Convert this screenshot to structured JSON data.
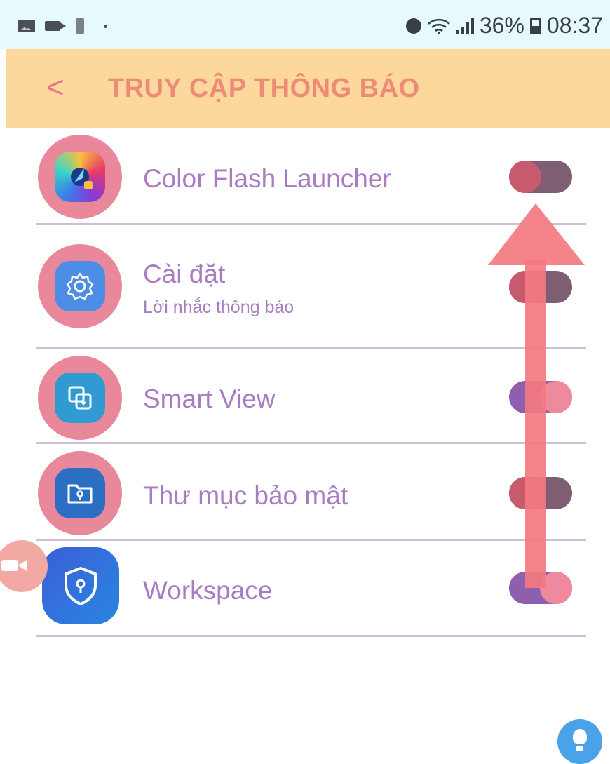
{
  "status_bar": {
    "battery_percent": "36%",
    "time": "08:37"
  },
  "header": {
    "back_glyph": "<",
    "title": "TRUY CẬP THÔNG BÁO"
  },
  "apps": [
    {
      "name": "Color Flash Launcher",
      "subtitle": "",
      "enabled": false,
      "icon": "color-flash-launcher-icon"
    },
    {
      "name": "Cài đặt",
      "subtitle": "Lời nhắc thông báo",
      "enabled": false,
      "icon": "settings-gear-icon"
    },
    {
      "name": "Smart View",
      "subtitle": "",
      "enabled": true,
      "icon": "smart-view-icon"
    },
    {
      "name": "Thư mục bảo mật",
      "subtitle": "",
      "enabled": false,
      "icon": "secure-folder-icon"
    },
    {
      "name": "Workspace",
      "subtitle": "",
      "enabled": true,
      "icon": "workspace-shield-icon"
    }
  ],
  "colors": {
    "header_bg": "#fcd89d",
    "title": "#ef8a78",
    "label": "#a97bc0",
    "arrow": "#f47a80"
  }
}
